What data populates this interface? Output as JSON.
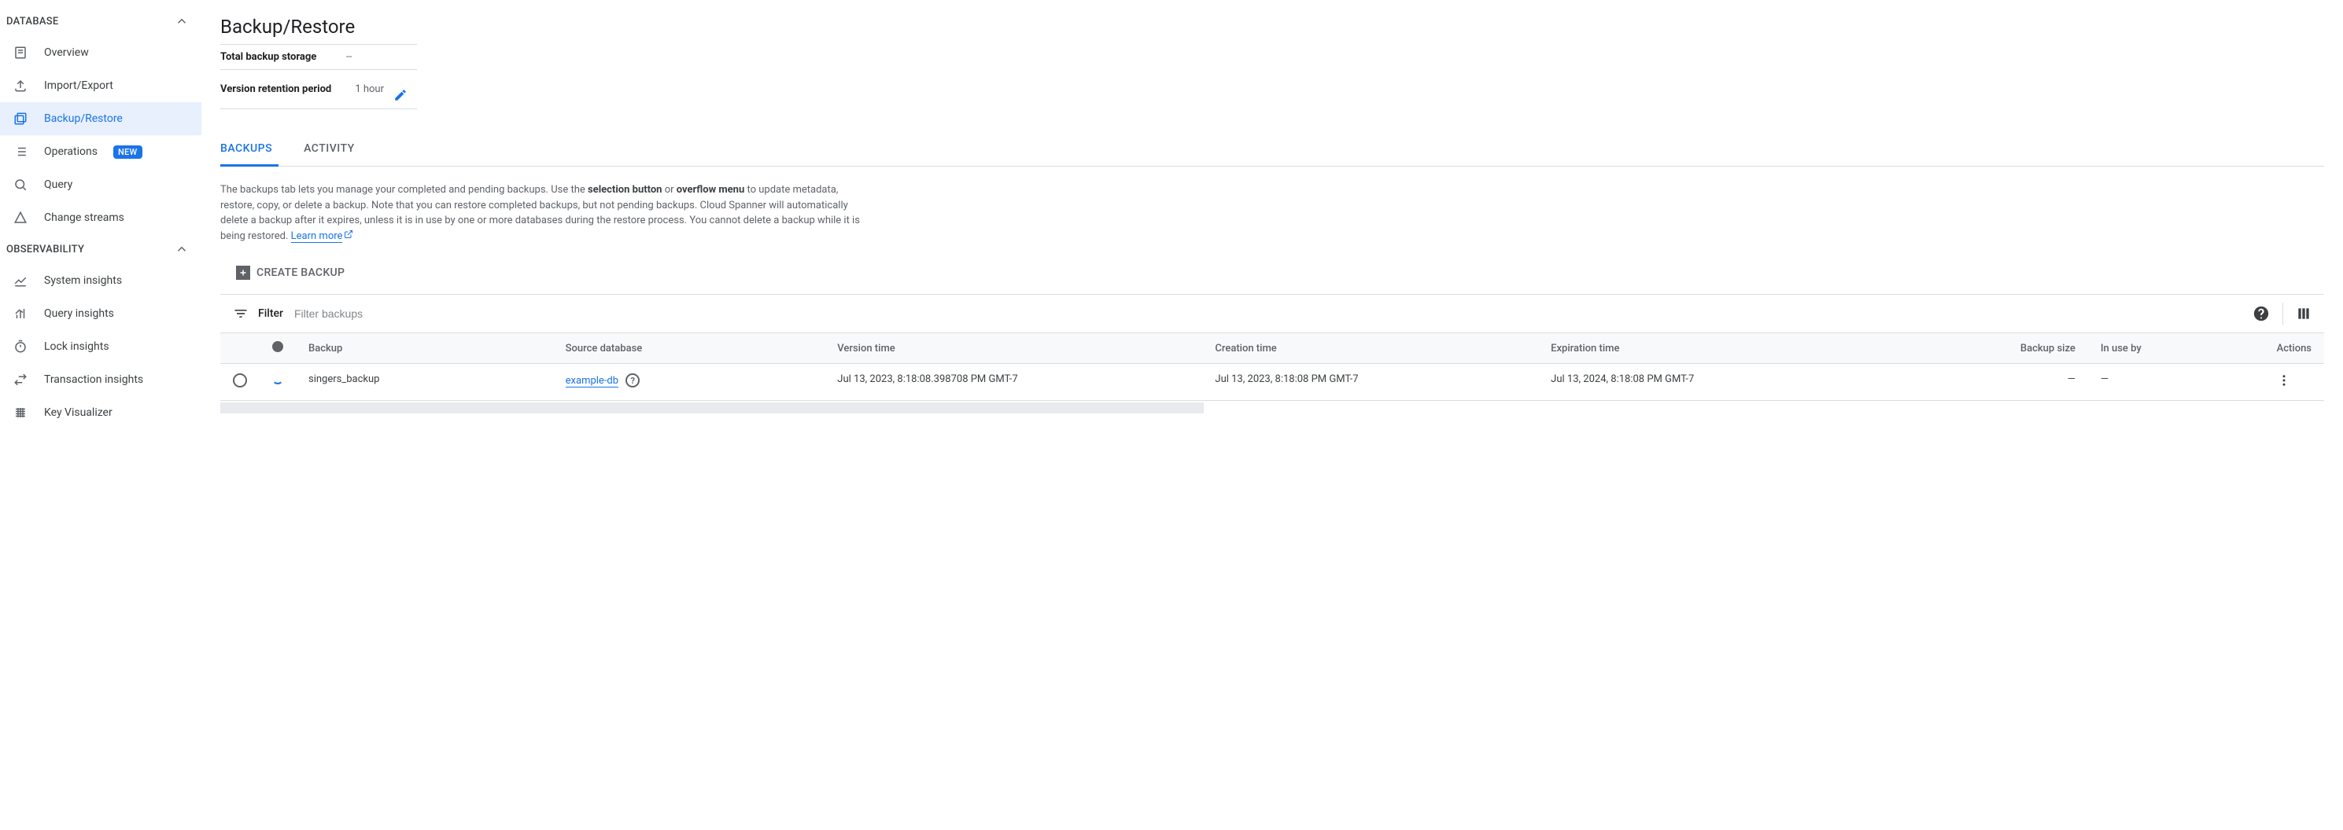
{
  "sidebar": {
    "sections": [
      {
        "title": "DATABASE",
        "items": [
          {
            "label": "Overview",
            "icon": "overview"
          },
          {
            "label": "Import/Export",
            "icon": "upload"
          },
          {
            "label": "Backup/Restore",
            "icon": "backup",
            "active": true
          },
          {
            "label": "Operations",
            "icon": "list",
            "badge": "NEW"
          },
          {
            "label": "Query",
            "icon": "search"
          },
          {
            "label": "Change streams",
            "icon": "change"
          }
        ]
      },
      {
        "title": "OBSERVABILITY",
        "items": [
          {
            "label": "System insights",
            "icon": "line-chart"
          },
          {
            "label": "Query insights",
            "icon": "bar-chart"
          },
          {
            "label": "Lock insights",
            "icon": "stopwatch"
          },
          {
            "label": "Transaction insights",
            "icon": "swap"
          },
          {
            "label": "Key Visualizer",
            "icon": "grid"
          }
        ]
      }
    ]
  },
  "header": {
    "title": "Backup/Restore",
    "info": [
      {
        "label": "Total backup storage",
        "value": "--"
      },
      {
        "label": "Version retention period",
        "value": "1 hour",
        "editable": true
      }
    ]
  },
  "tabs": [
    {
      "label": "BACKUPS",
      "active": true
    },
    {
      "label": "ACTIVITY"
    }
  ],
  "description": {
    "prefix": "The backups tab lets you manage your completed and pending backups. Use the ",
    "bold1": "selection button",
    "mid1": " or ",
    "bold2": "overflow menu",
    "suffix": " to update metadata, restore, copy, or delete a backup. Note that you can restore completed backups, but not pending backups. Cloud Spanner will automatically delete a backup after it expires, unless it is in use by one or more databases during the restore process. You cannot delete a backup while it is being restored. ",
    "link_text": "Learn more"
  },
  "create_button": "CREATE BACKUP",
  "filter": {
    "label": "Filter",
    "placeholder": "Filter backups"
  },
  "table": {
    "columns": [
      "",
      "",
      "Backup",
      "Source database",
      "Version time",
      "Creation time",
      "Expiration time",
      "Backup size",
      "In use by",
      "Actions"
    ],
    "rows": [
      {
        "backup": "singers_backup",
        "source_db": "example-db",
        "version_time": "Jul 13, 2023, 8:18:08.398708 PM GMT-7",
        "creation_time": "Jul 13, 2023, 8:18:08 PM GMT-7",
        "expiration_time": "Jul 13, 2024, 8:18:08 PM GMT-7",
        "backup_size": "—",
        "in_use_by": "—"
      }
    ]
  }
}
